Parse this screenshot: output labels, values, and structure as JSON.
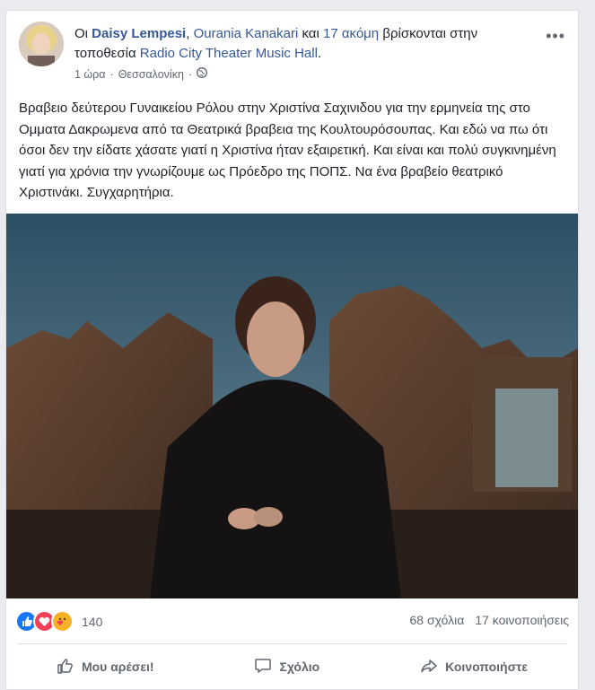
{
  "post": {
    "author_prefix": "Οι",
    "author": "Daisy Lempesi",
    "separator": ",",
    "second_person": "Ourania Kanakari",
    "connector": "και",
    "others": "17 ακόμη",
    "location_text": "βρίσκονται στην τοποθεσία",
    "place": "Radio City Theater Music Hall",
    "end": ".",
    "time": "1 ώρα",
    "dot": "·",
    "city": "Θεσσαλονίκη",
    "audience_icon": "globe-icon",
    "more_icon": "more-options-icon",
    "body": "Βραβειο δεύτερου Γυναικείου Ρόλου στην Χριστίνα Σαχινιδου για την ερμηνεία της στο Ομματα Δακρωμενα από τα Θεατρικά βραβεια της Κουλτουρόσουπας. Και εδώ να πω ότι όσοι δεν την είδατε χάσατε γιατί η Χριστίνα ήταν εξαιρετική. Και είναι και πολύ συγκινημένη γιατί για χρόνια την γνωρίζουμε ως Πρόεδρο της ΠΟΠΣ. Να ένα βραβείο θεατρικό Χριστινάκι. Συγχαρητήρια."
  },
  "stats": {
    "reactions_count": "140",
    "comments": "68 σχόλια",
    "shares": "17 κοινοποιήσεις",
    "reaction_icons": [
      "like-icon",
      "love-icon",
      "care-icon"
    ]
  },
  "actions": {
    "like": "Μου αρέσει!",
    "comment": "Σχόλιο",
    "share": "Κοινοποιήστε"
  },
  "colors": {
    "link": "#365899",
    "text": "#1d2129",
    "muted": "#606770",
    "like_blue": "#1877f2",
    "love_red": "#f33e58",
    "care_yellow": "#f7b125"
  }
}
